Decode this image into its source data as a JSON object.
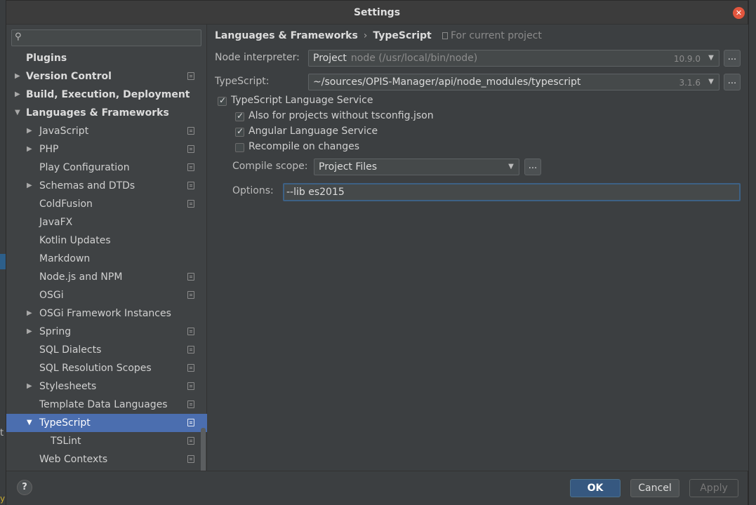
{
  "window": {
    "title": "Settings"
  },
  "search": {
    "placeholder": "",
    "value": ""
  },
  "sidebar": {
    "items": [
      {
        "label": "Plugins",
        "level": 0,
        "bold": true,
        "arrow": "",
        "project_icon": false
      },
      {
        "label": "Version Control",
        "level": 0,
        "bold": true,
        "arrow": "▶",
        "project_icon": true
      },
      {
        "label": "Build, Execution, Deployment",
        "level": 0,
        "bold": true,
        "arrow": "▶",
        "project_icon": false
      },
      {
        "label": "Languages & Frameworks",
        "level": 0,
        "bold": true,
        "arrow": "▼",
        "project_icon": false
      },
      {
        "label": "JavaScript",
        "level": 1,
        "arrow": "▶",
        "project_icon": true
      },
      {
        "label": "PHP",
        "level": 1,
        "arrow": "▶",
        "project_icon": true
      },
      {
        "label": "Play Configuration",
        "level": 1,
        "arrow": "",
        "project_icon": true
      },
      {
        "label": "Schemas and DTDs",
        "level": 1,
        "arrow": "▶",
        "project_icon": true
      },
      {
        "label": "ColdFusion",
        "level": 1,
        "arrow": "",
        "project_icon": true
      },
      {
        "label": "JavaFX",
        "level": 1,
        "arrow": "",
        "project_icon": false
      },
      {
        "label": "Kotlin Updates",
        "level": 1,
        "arrow": "",
        "project_icon": false
      },
      {
        "label": "Markdown",
        "level": 1,
        "arrow": "",
        "project_icon": false
      },
      {
        "label": "Node.js and NPM",
        "level": 1,
        "arrow": "",
        "project_icon": true
      },
      {
        "label": "OSGi",
        "level": 1,
        "arrow": "",
        "project_icon": true
      },
      {
        "label": "OSGi Framework Instances",
        "level": 1,
        "arrow": "▶",
        "project_icon": false
      },
      {
        "label": "Spring",
        "level": 1,
        "arrow": "▶",
        "project_icon": true
      },
      {
        "label": "SQL Dialects",
        "level": 1,
        "arrow": "",
        "project_icon": true
      },
      {
        "label": "SQL Resolution Scopes",
        "level": 1,
        "arrow": "",
        "project_icon": true
      },
      {
        "label": "Stylesheets",
        "level": 1,
        "arrow": "▶",
        "project_icon": true
      },
      {
        "label": "Template Data Languages",
        "level": 1,
        "arrow": "",
        "project_icon": true
      },
      {
        "label": "TypeScript",
        "level": 1,
        "arrow": "▼",
        "project_icon": true,
        "selected": true
      },
      {
        "label": "TSLint",
        "level": 2,
        "arrow": "",
        "project_icon": true
      },
      {
        "label": "Web Contexts",
        "level": 1,
        "arrow": "",
        "project_icon": true
      }
    ]
  },
  "breadcrumb": {
    "parent": "Languages & Frameworks",
    "separator": "›",
    "current": "TypeScript"
  },
  "scope_note": "For current project",
  "node": {
    "label": "Node interpreter:",
    "value": "Project",
    "detail": "node (/usr/local/bin/node)",
    "version": "10.9.0"
  },
  "typescript": {
    "label": "TypeScript:",
    "value": "~/sources/OPIS-Manager/api/node_modules/typescript",
    "version": "3.1.6"
  },
  "checkboxes": {
    "service": {
      "label": "TypeScript Language Service",
      "checked": true
    },
    "no_tsconfig": {
      "label": "Also for projects without tsconfig.json",
      "checked": true
    },
    "angular": {
      "label": "Angular Language Service",
      "checked": true
    },
    "recompile": {
      "label": "Recompile on changes",
      "checked": false
    }
  },
  "compile_scope": {
    "label": "Compile scope:",
    "value": "Project Files"
  },
  "options": {
    "label": "Options:",
    "value": "--lib es2015"
  },
  "buttons": {
    "dots": "...",
    "help": "?",
    "ok": "OK",
    "cancel": "Cancel",
    "apply": "Apply"
  },
  "icons": {
    "search": "search-icon",
    "close": "close-icon",
    "project_scope": "project-scope-icon",
    "dropdown": "chevron-down-icon",
    "expand": "chevron-right-icon",
    "collapse": "chevron-down-icon"
  },
  "background": {
    "fragment_left": "t",
    "fragment_bottom": "y"
  },
  "colors": {
    "selection": "#4b6eaf",
    "ok_button": "#365880",
    "focus": "#3d6185",
    "close": "#e2563e"
  }
}
